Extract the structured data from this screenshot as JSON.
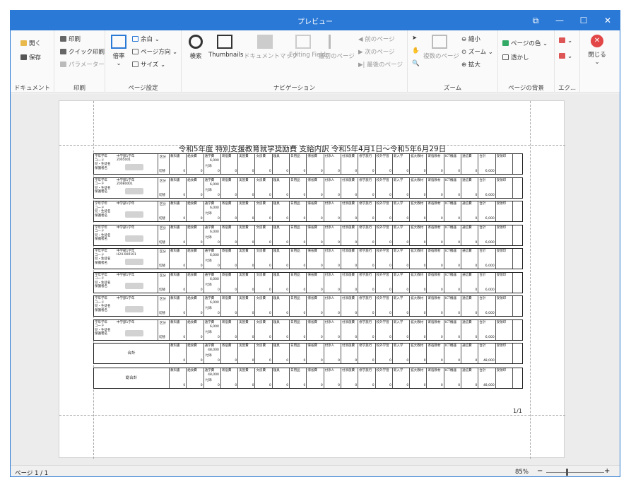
{
  "window": {
    "title": "プレビュー",
    "controls": {
      "restore": "⧉",
      "minimize": "—",
      "maximize": "☐",
      "close": "✕"
    }
  },
  "ribbon": {
    "document": {
      "label": "ドキュメント",
      "open": "開く",
      "save": "保存"
    },
    "print": {
      "label": "印刷",
      "print": "印刷",
      "quick_print": "クイック印刷",
      "parameters": "パラメーター"
    },
    "page_setup": {
      "label": "ページ設定",
      "scale": "倍率",
      "margins": "余白",
      "orientation": "ページ方向",
      "size": "サイズ"
    },
    "navigation": {
      "label": "ナビゲーション",
      "search": "検索",
      "thumbnails": "Thumbnails",
      "document_map": "ドキュメントマップ",
      "editing_fields": "Editing Fields",
      "first_page": "最初のページ",
      "prev_page": "前のページ",
      "next_page": "次のページ",
      "last_page": "最後のページ"
    },
    "zoom": {
      "label": "ズーム",
      "multi_page": "複数のページ",
      "zoom_out": "縮小",
      "zoom": "ズーム",
      "zoom_in": "拡大"
    },
    "background": {
      "label": "ページの背景",
      "page_color": "ページの色",
      "watermark": "透かし"
    },
    "export": {
      "label": "エク..."
    },
    "close": {
      "label": "閉じる"
    }
  },
  "report": {
    "title": "令和5年度 特別支援教育就学奨励費 支給内訳 令和5年4月1日～令和5年6月29日",
    "row_labels": [
      "学年学年",
      "コード",
      "児・生徒名",
      "保護者名"
    ],
    "class_label": "中学部1学年",
    "division_header": "区分",
    "division_value": "切替",
    "columns": [
      "教科書",
      "給食費",
      "通学費",
      "寄宿費",
      "実習費",
      "文房費",
      "寝具",
      "日用品",
      "帰省費",
      "付添人",
      "付添旅費",
      "修学旅行",
      "校外学習",
      "新入学",
      "拡大教材",
      "寄宿教材",
      "ICT機器",
      "通信費",
      "合計",
      "受領印"
    ],
    "subrows": {
      "tuugaku_main": "6,000",
      "tuugaku_sub": "付添",
      "sum": "6,000",
      "total_tuugaku": "48,000",
      "total_sum": "48,000"
    },
    "students": [
      {
        "code": "2005001"
      },
      {
        "code": "20080001"
      },
      {
        "code": ""
      },
      {
        "code": ""
      },
      {
        "code": "H24-000101"
      },
      {
        "code": ""
      },
      {
        "code": ""
      },
      {
        "code": ""
      }
    ],
    "total_label": "合計",
    "grand_total_label": "総合計",
    "page_number": "1/1"
  },
  "status": {
    "page": "ページ 1 / 1",
    "zoom": "85%",
    "minus": "−",
    "plus": "+"
  },
  "colors": {
    "accent": "#2b79d6",
    "close_red": "#e24646"
  }
}
